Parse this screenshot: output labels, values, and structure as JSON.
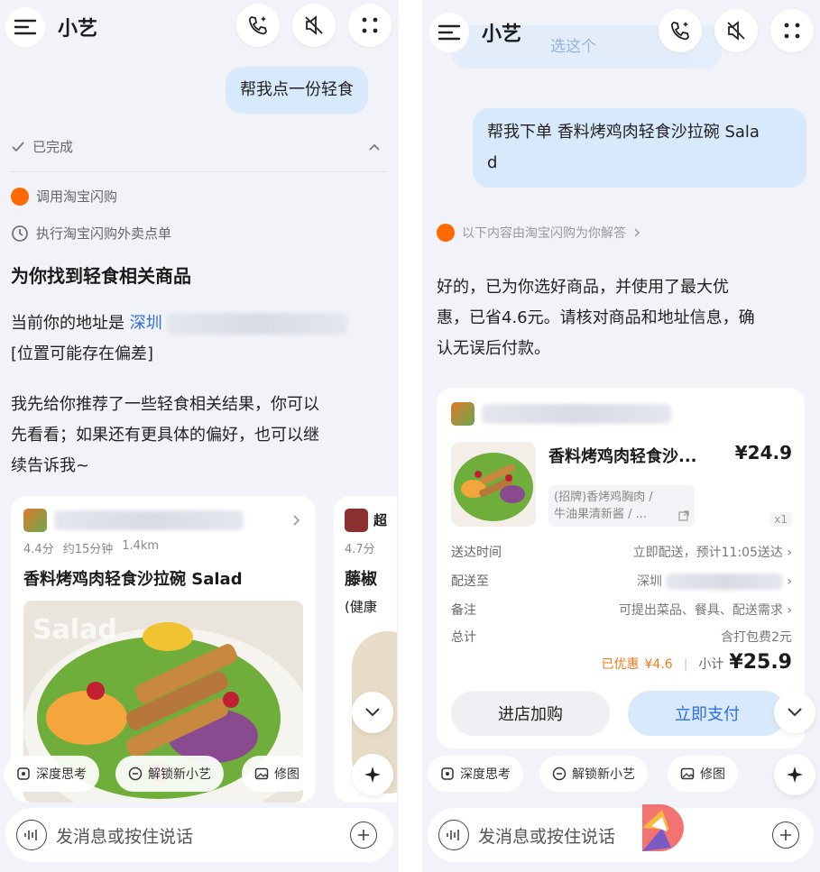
{
  "left": {
    "title": "小艺",
    "user_message": "帮我点一份轻食",
    "status": "已完成",
    "step1": "调用淘宝闪购",
    "step2": "执行淘宝闪购外卖点单",
    "heading": "为你找到轻食相关商品",
    "address_prefix": "当前你的地址是 ",
    "address_city": "深圳",
    "address_note": "[位置可能存在偏差]",
    "reply_line1": "我先给你推荐了一些轻食相关结果，你可以",
    "reply_line2": "先看看；如果还有更具体的偏好，也可以继",
    "reply_line3": "续告诉我~",
    "card1": {
      "rating": "4.4分",
      "time": "约15分钟",
      "distance": "1.4km",
      "product": "香料烤鸡肉轻食沙拉碗 Salad",
      "img_text": "Salad"
    },
    "card2": {
      "shop_partial": "超",
      "rating": "4.7分",
      "product_partial": "藤椒",
      "sub_partial": "(健康"
    },
    "chips": [
      "深度思考",
      "解锁新小艺",
      "修图"
    ],
    "input_placeholder": "发消息或按住说话"
  },
  "right": {
    "title": "小艺",
    "faded_bubble": "选这个",
    "user_message_line1": "帮我下单 香料烤鸡肉轻食沙拉碗 Sala",
    "user_message_line2": "d",
    "source_note": "以下内容由淘宝闪购为你解答",
    "reply_line1": "好的，已为你选好商品，并使用了最大优",
    "reply_line2": "惠，已省4.6元。请核对商品和地址信息，确",
    "reply_line3": "认无误后付款。",
    "order": {
      "product": "香料烤鸡肉轻食沙...",
      "price": "¥24.9",
      "spec_line1": "(招牌)香烤鸡胸肉 /",
      "spec_line2": "牛油果清新酱 / ...",
      "qty": "x1",
      "rows": [
        {
          "label": "送达时间",
          "value": "立即配送，预计11:05送达"
        },
        {
          "label": "配送至",
          "value": "深圳"
        },
        {
          "label": "备注",
          "value": "可提出菜品、餐具、配送需求"
        },
        {
          "label": "总计",
          "value": "含打包费2元"
        }
      ],
      "discount_label": "已优惠",
      "discount_value": "¥4.6",
      "subtotal_label": "小计",
      "subtotal_value": "¥25.9",
      "btn_add": "进店加购",
      "btn_pay": "立即支付"
    },
    "chips": [
      "深度思考",
      "解锁新小艺",
      "修图"
    ],
    "input_placeholder": "发消息或按住说话"
  },
  "colors": {
    "accent_blue": "#2c6ee6",
    "bubble_blue": "#d8e9fb",
    "discount_orange": "#f07b1a",
    "brand_orange": "#ff6a00"
  }
}
